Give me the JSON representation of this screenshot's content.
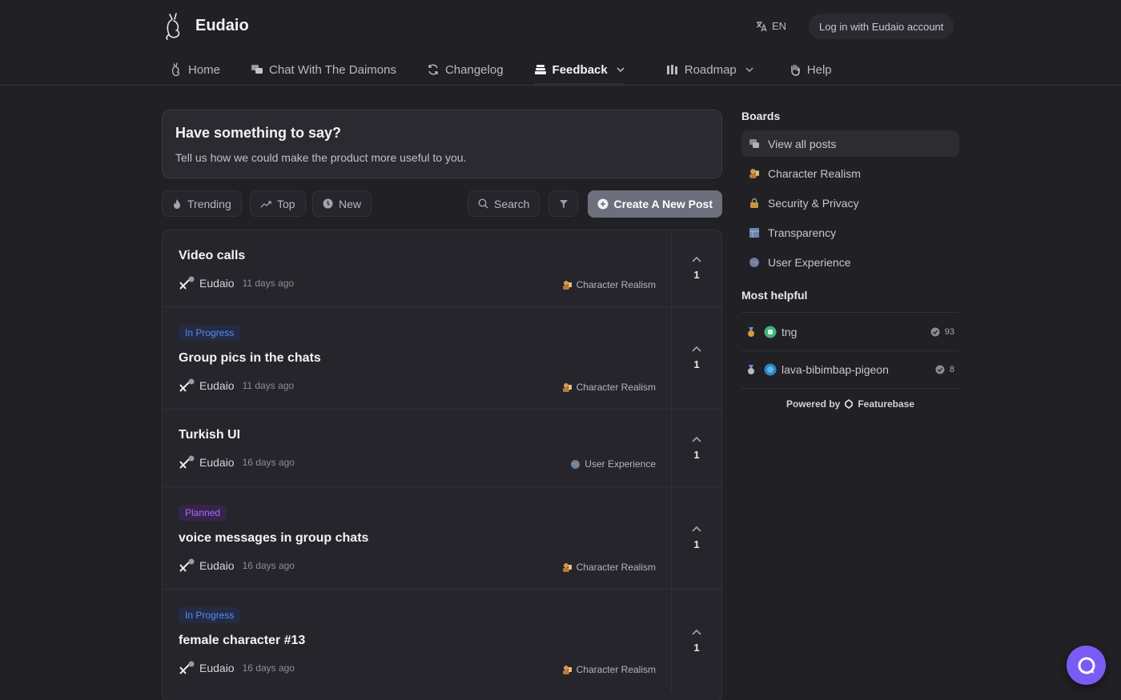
{
  "header": {
    "brand": "Eudaio",
    "language": "EN",
    "login_label": "Log in with Eudaio account"
  },
  "nav": [
    {
      "label": "Home",
      "icon": "cat-icon"
    },
    {
      "label": "Chat With The Daimons",
      "icon": "chat-bubbles-icon"
    },
    {
      "label": "Changelog",
      "icon": "refresh-icon"
    },
    {
      "label": "Feedback",
      "icon": "inbox-stack-icon",
      "active": true
    },
    {
      "label": "Roadmap",
      "icon": "columns-icon"
    },
    {
      "label": "Help",
      "icon": "hand-icon"
    }
  ],
  "hero": {
    "title": "Have something to say?",
    "subtitle": "Tell us how we could make the product more useful to you."
  },
  "toolbar": {
    "trending": "Trending",
    "top": "Top",
    "new": "New",
    "search": "Search",
    "create": "Create A New Post"
  },
  "posts": [
    {
      "title": "Video calls",
      "status": "",
      "author": "Eudaio",
      "time": "11 days ago",
      "board": "Character Realism",
      "votes": "1"
    },
    {
      "title": "Group pics in the chats",
      "status": "In Progress",
      "author": "Eudaio",
      "time": "11 days ago",
      "board": "Character Realism",
      "votes": "1"
    },
    {
      "title": "Turkish UI",
      "status": "",
      "author": "Eudaio",
      "time": "16 days ago",
      "board": "User Experience",
      "votes": "1"
    },
    {
      "title": "voice messages in group chats",
      "status": "Planned",
      "author": "Eudaio",
      "time": "16 days ago",
      "board": "Character Realism",
      "votes": "1"
    },
    {
      "title": "female character #13",
      "status": "In Progress",
      "author": "Eudaio",
      "time": "16 days ago",
      "board": "Character Realism",
      "votes": "1"
    }
  ],
  "sidebar": {
    "boards_heading": "Boards",
    "boards": [
      {
        "label": "View all posts",
        "icon": "posts-icon"
      },
      {
        "label": "Character Realism",
        "icon": "person-icon"
      },
      {
        "label": "Security & Privacy",
        "icon": "lock-icon"
      },
      {
        "label": "Transparency",
        "icon": "window-icon"
      },
      {
        "label": "User Experience",
        "icon": "globe-icon"
      }
    ],
    "helpful_heading": "Most helpful",
    "helpful": [
      {
        "name": "tng",
        "count": "93"
      },
      {
        "name": "lava-bibimbap-pigeon",
        "count": "8"
      }
    ],
    "powered_prefix": "Powered by",
    "powered_brand": "Featurebase"
  },
  "colors": {
    "background": "#202025",
    "accent": "#7a5cf5",
    "in_progress": "#5a8cf0",
    "planned": "#b06af0"
  }
}
